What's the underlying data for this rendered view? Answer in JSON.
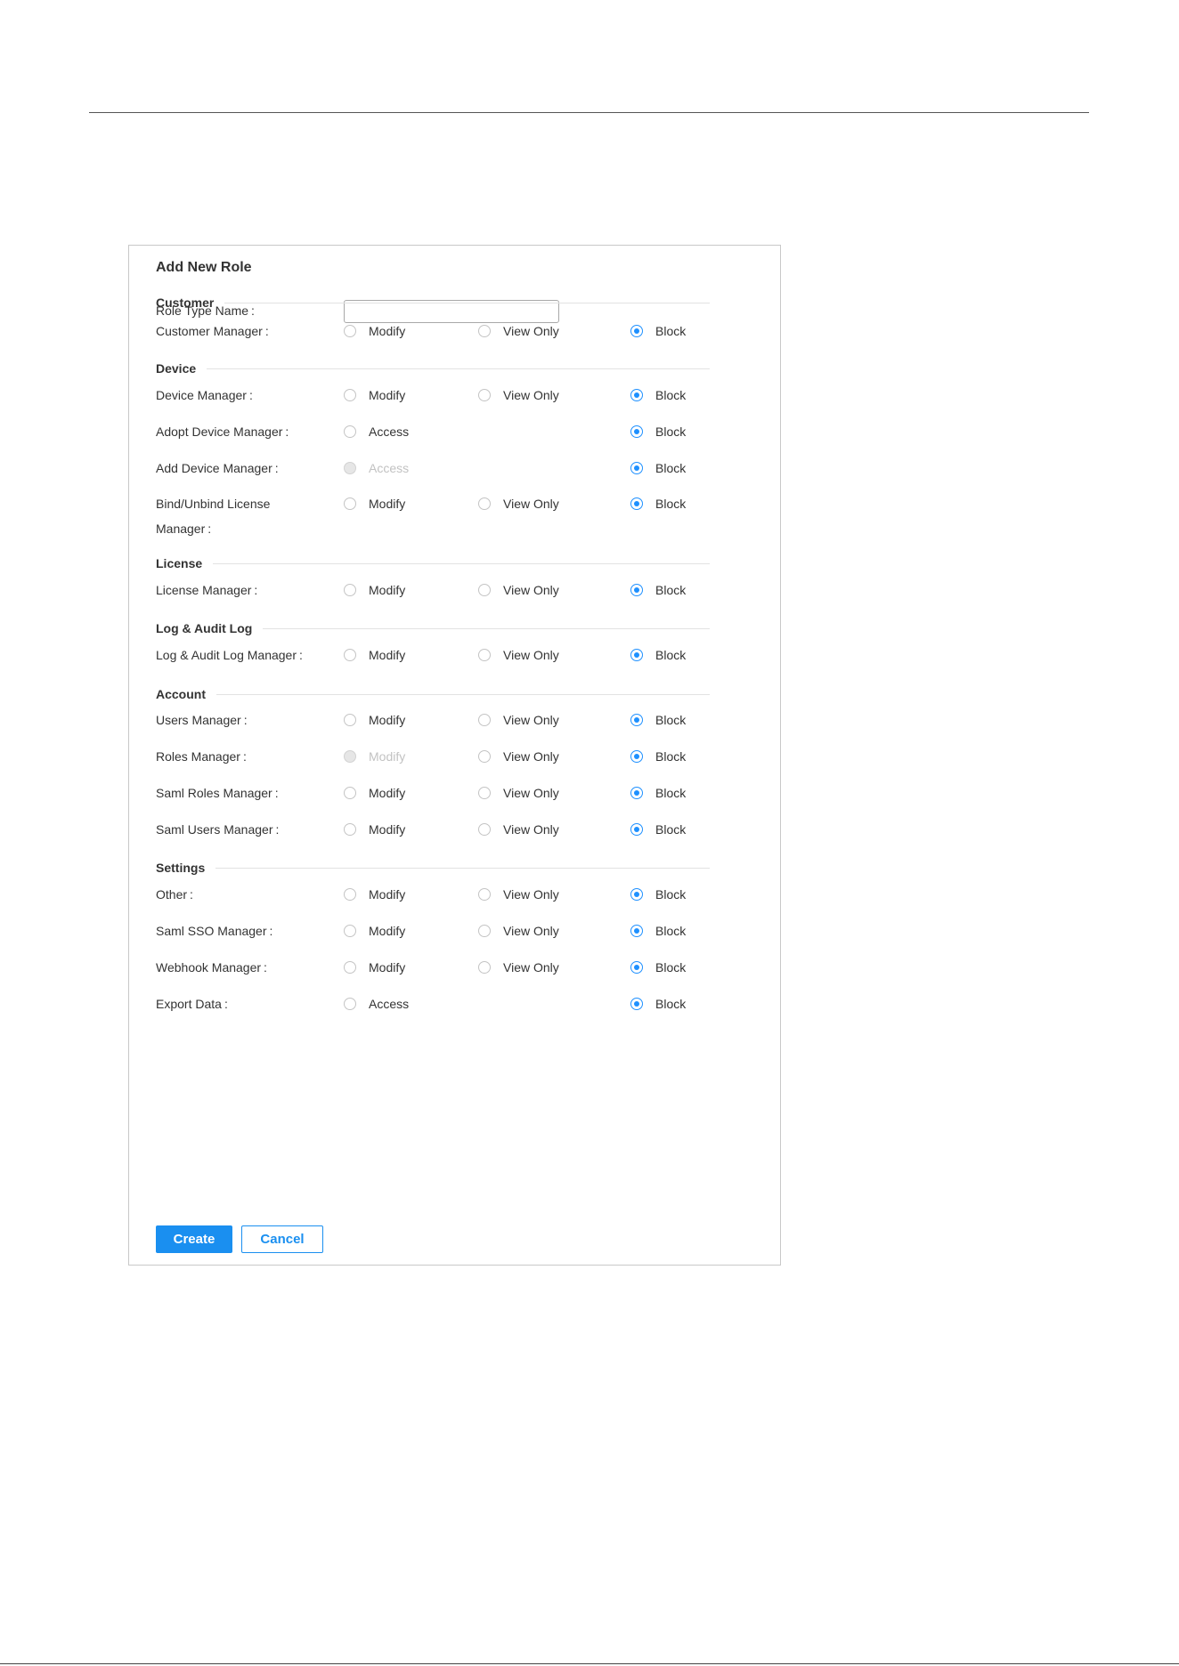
{
  "form": {
    "title": "Add New Role",
    "role_name_label": "Role Type Name",
    "role_name_value": "",
    "colon": ":"
  },
  "options": {
    "modify": "Modify",
    "view_only": "View Only",
    "block": "Block",
    "access": "Access"
  },
  "sections": [
    {
      "title": "Customer",
      "rows": [
        {
          "label": "Customer Manager",
          "options": [
            "Modify",
            "View Only",
            "Block"
          ],
          "selected": "Block",
          "disabled": []
        }
      ]
    },
    {
      "title": "Device",
      "rows": [
        {
          "label": "Device Manager",
          "options": [
            "Modify",
            "View Only",
            "Block"
          ],
          "selected": "Block",
          "disabled": []
        },
        {
          "label": "Adopt Device Manager",
          "options": [
            "Access",
            "Block"
          ],
          "selected": "Block",
          "disabled": []
        },
        {
          "label": "Add Device Manager",
          "options": [
            "Access",
            "Block"
          ],
          "selected": "Block",
          "disabled": [
            "Access"
          ]
        },
        {
          "label": "Bind/Unbind License Manager",
          "options": [
            "Modify",
            "View Only",
            "Block"
          ],
          "selected": "Block",
          "disabled": []
        }
      ]
    },
    {
      "title": "License",
      "rows": [
        {
          "label": "License Manager",
          "options": [
            "Modify",
            "View Only",
            "Block"
          ],
          "selected": "Block",
          "disabled": []
        }
      ]
    },
    {
      "title": "Log & Audit Log",
      "rows": [
        {
          "label": "Log & Audit Log Manager",
          "options": [
            "Modify",
            "View Only",
            "Block"
          ],
          "selected": "Block",
          "disabled": []
        }
      ]
    },
    {
      "title": "Account",
      "rows": [
        {
          "label": "Users Manager",
          "options": [
            "Modify",
            "View Only",
            "Block"
          ],
          "selected": "Block",
          "disabled": []
        },
        {
          "label": "Roles Manager",
          "options": [
            "Modify",
            "View Only",
            "Block"
          ],
          "selected": "Block",
          "disabled": [
            "Modify"
          ]
        },
        {
          "label": "Saml Roles Manager",
          "options": [
            "Modify",
            "View Only",
            "Block"
          ],
          "selected": "Block",
          "disabled": []
        },
        {
          "label": "Saml Users Manager",
          "options": [
            "Modify",
            "View Only",
            "Block"
          ],
          "selected": "Block",
          "disabled": []
        }
      ]
    },
    {
      "title": "Settings",
      "rows": [
        {
          "label": "Other",
          "options": [
            "Modify",
            "View Only",
            "Block"
          ],
          "selected": "Block",
          "disabled": []
        },
        {
          "label": "Saml SSO Manager",
          "options": [
            "Modify",
            "View Only",
            "Block"
          ],
          "selected": "Block",
          "disabled": []
        },
        {
          "label": "Webhook Manager",
          "options": [
            "Modify",
            "View Only",
            "Block"
          ],
          "selected": "Block",
          "disabled": []
        },
        {
          "label": "Export Data",
          "options": [
            "Access",
            "Block"
          ],
          "selected": "Block",
          "disabled": []
        }
      ]
    }
  ],
  "buttons": {
    "create": "Create",
    "cancel": "Cancel"
  },
  "colors": {
    "primary": "#1a8ff0",
    "radio_checked": "#1e90ff",
    "disabled_text": "#c2c2c2"
  }
}
